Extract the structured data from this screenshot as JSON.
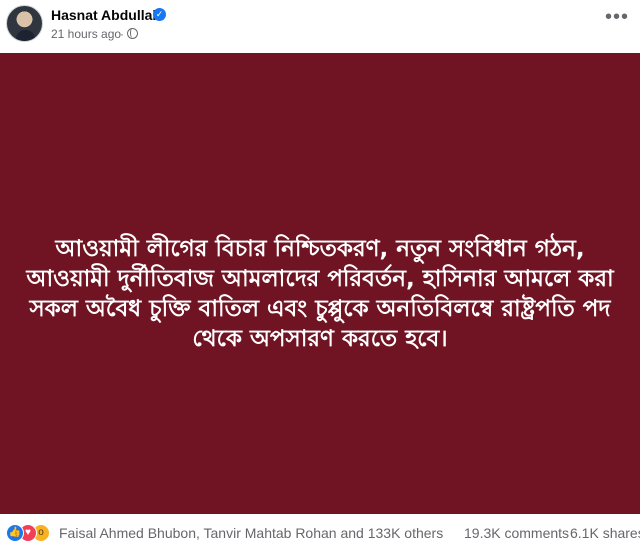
{
  "post": {
    "author": "Hasnat Abdullah",
    "time": "21 hours ago",
    "separator": "·",
    "text": "আওয়ামী লীগের বিচার নিশ্চিতকরণ, নতুন সংবিধান গঠন, আওয়ামী দুর্নীতিবাজ আমলাদের পরিবর্তন, হাসিনার আমলে করা সকল অবৈধ চুক্তি বাতিল এবং চুপ্পুকে অনতিবিলম্বে রাষ্ট্রপতি পদ থেকে অপসারণ করতে হবে।",
    "background_color": "#701424"
  },
  "icons": {
    "verified": "verified-badge-icon",
    "privacy": "globe-icon",
    "more": "more-options-icon",
    "reactions": [
      "like-icon",
      "love-icon",
      "wow-icon"
    ]
  },
  "engagement": {
    "reaction_names": "Faisal Ahmed Bhubon, Tanvir Mahtab Rohan and 133K others",
    "comments": "19.3K comments",
    "shares": "6.1K shares"
  },
  "colors": {
    "secondary_text": "#65676b",
    "verified": "#1877f2"
  }
}
